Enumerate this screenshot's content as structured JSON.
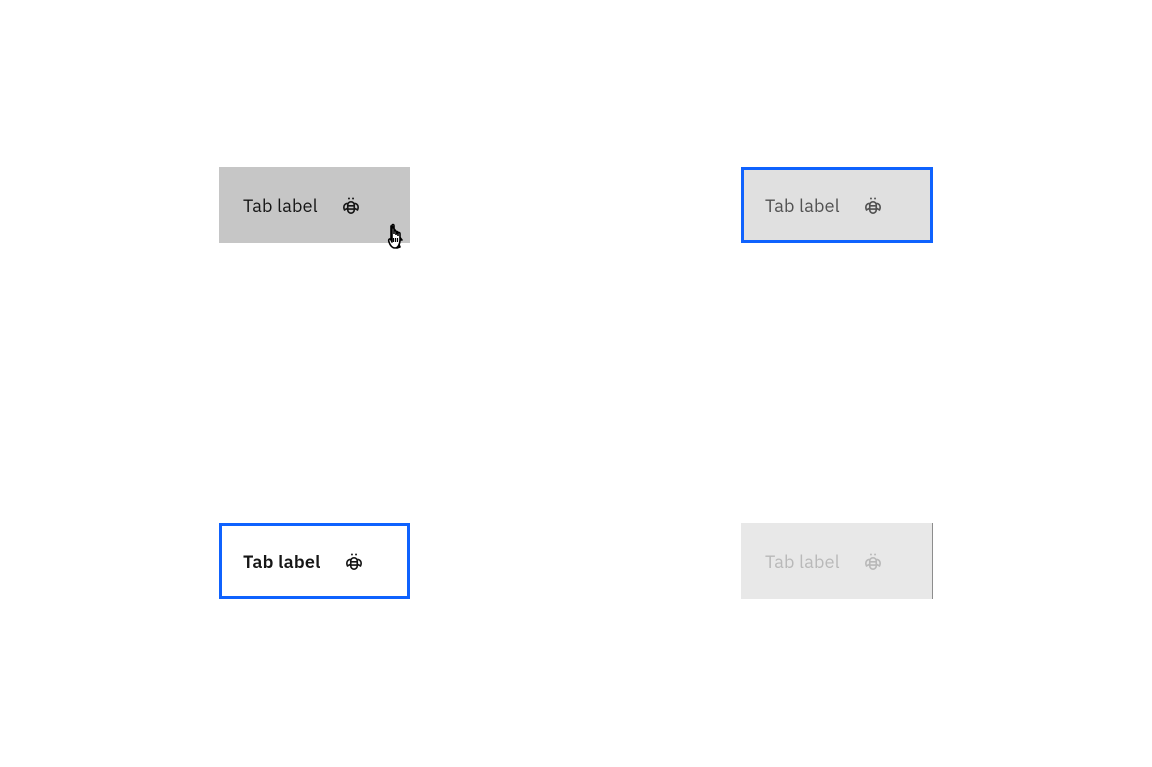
{
  "tabs": {
    "hover": {
      "label": "Tab label"
    },
    "focus": {
      "label": "Tab label"
    },
    "selected_focus": {
      "label": "Tab label"
    },
    "disabled": {
      "label": "Tab label"
    }
  }
}
